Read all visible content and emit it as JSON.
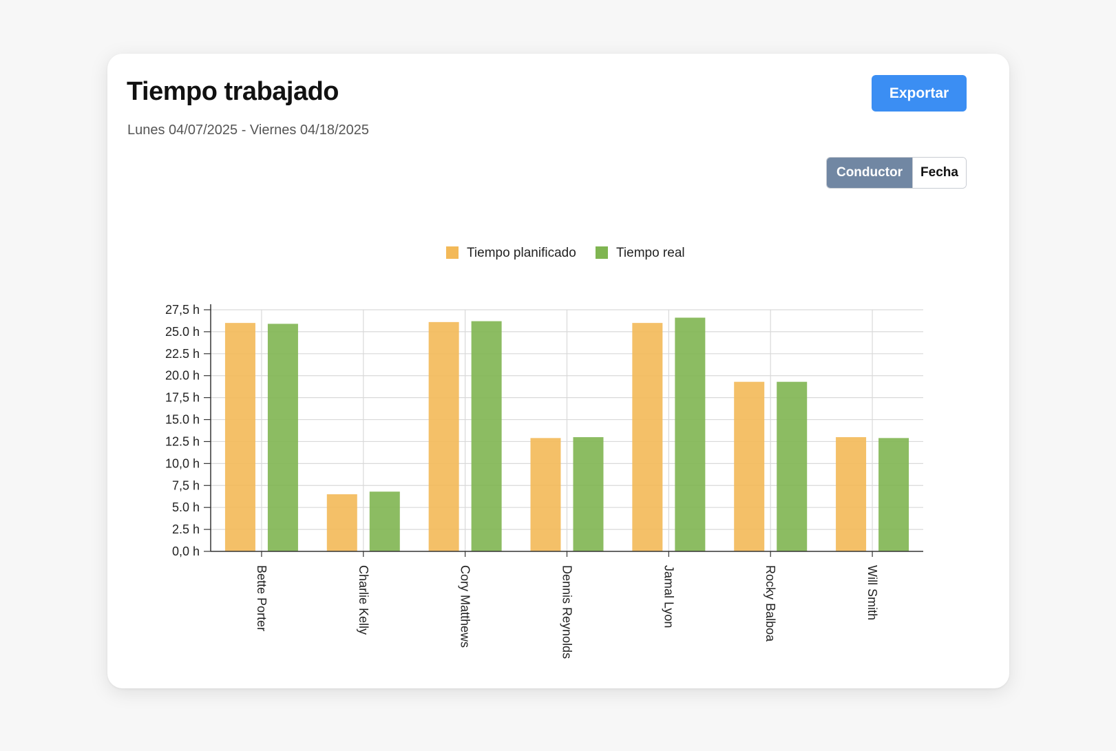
{
  "header": {
    "title": "Tiempo trabajado",
    "date_range": "Lunes 04/07/2025 - Viernes 04/18/2025",
    "export_label": "Exportar"
  },
  "view_toggle": {
    "options": [
      "Conductor",
      "Fecha"
    ],
    "selected": "Conductor"
  },
  "colors": {
    "planned": "#f3b958",
    "actual": "#7fb551",
    "accent": "#3b8ef3",
    "toggle_active": "#7187a3"
  },
  "chart_data": {
    "type": "bar",
    "categories": [
      "Bette Porter",
      "Charlie Kelly",
      "Cory Matthews",
      "Dennis Reynolds",
      "Jamal Lyon",
      "Rocky Balboa",
      "Will Smith"
    ],
    "series": [
      {
        "name": "Tiempo planificado",
        "values": [
          26.0,
          6.5,
          26.1,
          12.9,
          26.0,
          19.3,
          13.0
        ]
      },
      {
        "name": "Tiempo real",
        "values": [
          25.9,
          6.8,
          26.2,
          13.0,
          26.6,
          19.3,
          12.9
        ]
      }
    ],
    "yticks": [
      "0,0 h",
      "2.5 h",
      "5.0 h",
      "7,5 h",
      "10,0 h",
      "12.5 h",
      "15.0 h",
      "17,5 h",
      "20.0 h",
      "22.5 h",
      "25.0 h",
      "27,5 h"
    ],
    "ylim": [
      0,
      27.5
    ],
    "grid": true,
    "legend_position": "top-center"
  }
}
